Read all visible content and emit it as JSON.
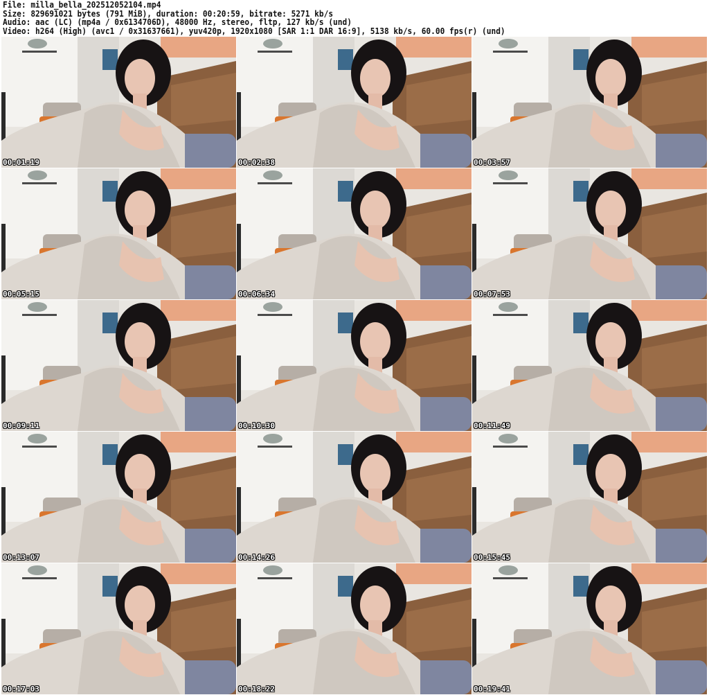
{
  "header": {
    "file_line": "File: milla_bella_202512052104.mp4",
    "size_line": "Size: 829691021 bytes (791 MiB), duration: 00:20:59, bitrate: 5271 kb/s",
    "audio_line": "Audio: aac (LC) (mp4a / 0x6134706D), 48000 Hz, stereo, fltp, 127 kb/s (und)",
    "video_line": "Video: h264 (High) (avc1 / 0x31637661), yuv420p, 1920x1080 [SAR 1:1 DAR 16:9], 5138 kb/s, 60.00 fps(r) (und)"
  },
  "thumbnails": [
    {
      "timestamp": "00:01:19"
    },
    {
      "timestamp": "00:02:38"
    },
    {
      "timestamp": "00:03:57"
    },
    {
      "timestamp": "00:05:15"
    },
    {
      "timestamp": "00:06:34"
    },
    {
      "timestamp": "00:07:53"
    },
    {
      "timestamp": "00:09:11"
    },
    {
      "timestamp": "00:10:30"
    },
    {
      "timestamp": "00:11:49"
    },
    {
      "timestamp": "00:13:07"
    },
    {
      "timestamp": "00:14:26"
    },
    {
      "timestamp": "00:15:45"
    },
    {
      "timestamp": "00:17:03"
    },
    {
      "timestamp": "00:18:22"
    },
    {
      "timestamp": "00:19:41"
    }
  ]
}
